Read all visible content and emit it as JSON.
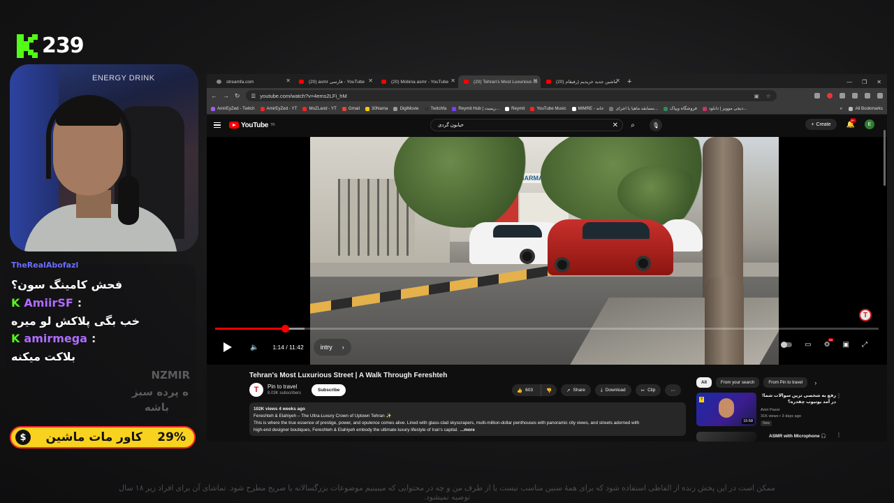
{
  "overlay": {
    "kick_count": "239",
    "webcam_brand": "ENERGY DRINK",
    "chat": [
      {
        "name": "TheRealAbofazl",
        "message": "فحش کامینگ سون؟"
      },
      {
        "name": "AmiirSF",
        "message": "خب بگی پلاکش لو میره"
      },
      {
        "name": "amirmega",
        "message": "بلاکت میکنه"
      }
    ],
    "faded_name": "NZMIR",
    "faded_message_1": "ه پرده سبز",
    "faded_message_2": "باشه",
    "banner_label": "کاور مات ماشین",
    "banner_percent": "29%",
    "banner_icon": "$",
    "disclaimer": "ممکن است در این پخش زنده از الفاظی استفاده شود که برای همهٔ سنین مناسب نیست یا از طرف من و چه در محتوایی که میبینیم موضوعات بزرگسالانه یا صریح مطرح شود. تماشای آن برای افراد زیر ۱۸ سال توصیه نمیشود."
  },
  "browser": {
    "tabs": [
      {
        "title": "streamfa.com",
        "favicon": "gray",
        "active": false
      },
      {
        "title": "(20) asmr فارسی - YouTube",
        "favicon": "red",
        "active": false
      },
      {
        "title": "(20) Mobina asmr - YouTube",
        "favicon": "red",
        "active": false
      },
      {
        "title": "(20) Tehran's Most Luxurious St",
        "favicon": "red",
        "active": true
      },
      {
        "title": "(20) ماشین جدید خریدیم (رفیقام",
        "favicon": "red",
        "active": false
      }
    ],
    "url": "youtube.com/watch?v=4ems2LFi_hM",
    "bookmarks": [
      "AmirEyZed - Twitch",
      "AmirEyZed - YT",
      "MoZLand - YT",
      "Gmail",
      "30Nama",
      "DigiMovie",
      "Twitchfa",
      "Reymit Hub | ریمیت...",
      "Reymit",
      "YouTube Music",
      "MIMRE - خانه",
      "مسابقه ماهیا با اجرای...",
      "فروشگاه ویپاک",
      "دیجی موویز | دانلود..."
    ],
    "all_bookmarks": "All Bookmarks"
  },
  "youtube": {
    "logo_text": "YouTube",
    "logo_country": "TR",
    "search_value": "خیابون گردی",
    "create_label": "Create",
    "notif_badge": "9+",
    "avatar_letter": "E",
    "player": {
      "time": "1:14 / 11:42",
      "chapter": "intry",
      "progress_played": 0.105,
      "progress_loaded": 0.135,
      "hd_badge": "HD"
    },
    "video": {
      "title": "Tehran's Most Luxurious Street | A Walk Through Fereshteh",
      "channel": "Pin to travel",
      "subscribers": "8.03K subscribers",
      "subscribe_label": "Subscribe",
      "likes": "603",
      "share_label": "Share",
      "download_label": "Download",
      "clip_label": "Clip",
      "views_date": "102K views  4 weeks ago",
      "description_line1": "Fereshteh & Elahiyeh – The Ultra-Luxury Crown of Uptown Tehran ✨",
      "description_line2": "This is where the true essence of prestige, power, and opulence comes alive. Lined with glass-clad skyscrapers, multi-million-dollar penthouses with panoramic city views, and streets adorned with",
      "description_line3": "high-end designer boutiques, Fereshteh & Elahiyeh embody the ultimate luxury lifestyle of Iran's capital.",
      "more_label": "...more"
    },
    "chips": [
      "All",
      "From your search",
      "From Pin to travel"
    ],
    "recommendations": [
      {
        "title": "رفع به شخصی ترین سوالات شما! در آمد یوتیوب چقدره؟",
        "channel": "Amir Paxer",
        "meta": "31K views • 3 days ago",
        "duration": "15:58",
        "badge": "New"
      },
      {
        "title": "ASMR with Microphone 🎧",
        "channel": "",
        "meta": "",
        "duration": "",
        "badge": ""
      }
    ]
  },
  "colors": {
    "kick_green": "#53fc18",
    "youtube_red": "#ff0000",
    "banner_yellow": "#f8d21e",
    "chat_name_purple": "#b06cff"
  }
}
